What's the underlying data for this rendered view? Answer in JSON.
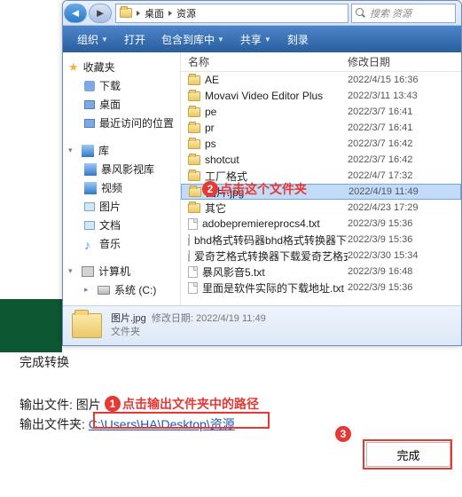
{
  "titlebar": {
    "bc1": "桌面",
    "bc2": "资源",
    "search_ph": "搜索 资源"
  },
  "cmdbar": {
    "org": "组织",
    "open": "打开",
    "include": "包含到库中",
    "share": "共享",
    "burn": "刻录"
  },
  "sidebar": {
    "fav": "收藏夹",
    "fav_items": [
      "下载",
      "桌面",
      "最近访问的位置"
    ],
    "lib": "库",
    "lib_items": [
      "暴风影视库",
      "视频",
      "图片",
      "文档",
      "音乐"
    ],
    "computer": "计算机",
    "disk": "系统 (C:)"
  },
  "cols": {
    "name": "名称",
    "mdate": "修改日期"
  },
  "rows": [
    {
      "n": "AE",
      "d": "2022/4/15 16:36",
      "t": "folder"
    },
    {
      "n": "Movavi Video Editor Plus",
      "d": "2022/3/11 13:43",
      "t": "folder"
    },
    {
      "n": "pe",
      "d": "2022/3/7 16:41",
      "t": "folder"
    },
    {
      "n": "pr",
      "d": "2022/3/7 16:41",
      "t": "folder"
    },
    {
      "n": "ps",
      "d": "2022/3/7 16:42",
      "t": "folder"
    },
    {
      "n": "shotcut",
      "d": "2022/3/7 16:42",
      "t": "folder"
    },
    {
      "n": "工厂格式",
      "d": "2022/4/7 17:32",
      "t": "folder",
      "cov": true
    },
    {
      "n": "图片.jpg",
      "d": "2022/4/19 11:49",
      "t": "folder",
      "sel": true
    },
    {
      "n": "其它",
      "d": "2022/4/23 17:29",
      "t": "folder",
      "cov2": true
    },
    {
      "n": "adobepremiereprocs4.txt",
      "d": "2022/3/9 15:36",
      "t": "file"
    },
    {
      "n": "bhd格式转码器bhd格式转换器下载.txt",
      "d": "2022/3/9 15:36",
      "t": "file"
    },
    {
      "n": "爱奇艺格式转换器下载爱奇艺格式转换工...",
      "d": "2022/3/30 15:34",
      "t": "file"
    },
    {
      "n": "暴风影音5.txt",
      "d": "2022/3/9 16:48",
      "t": "file"
    },
    {
      "n": "里面是软件实际的下载地址.txt",
      "d": "2022/3/9 15:36",
      "t": "file"
    }
  ],
  "status": {
    "name": "图片.jpg",
    "mdate": "修改日期: 2022/4/19 11:49",
    "type": "文件夹"
  },
  "bottom": {
    "finish_label": "完成转换",
    "out_file": "输出文件:",
    "out_file_v": "图片",
    "out_dir": "输出文件夹:",
    "out_dir_v": "C:\\Users\\HA\\Desktop\\资源",
    "done": "完成"
  },
  "anno": {
    "a2": "点击这个文件夹",
    "a1": "点击输出文件夹中的路径"
  }
}
